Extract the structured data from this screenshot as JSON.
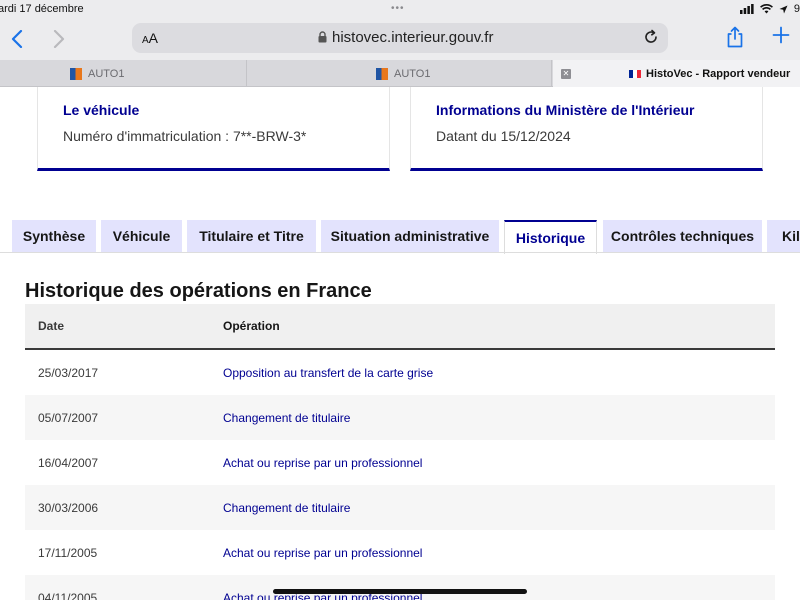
{
  "status": {
    "time": "ardi 17 décembre",
    "dots": "•••",
    "battery": "9"
  },
  "browser": {
    "aa_small": "A",
    "aa_large": "A",
    "url": "histovec.interieur.gouv.fr"
  },
  "tabs": [
    {
      "label": "AUTO1"
    },
    {
      "label": "AUTO1"
    },
    {
      "label": "HistoVec - Rapport vendeur"
    }
  ],
  "cards": {
    "vehicle": {
      "title": "Le véhicule",
      "text": "Numéro d'immatriculation : 7**-BRW-3*"
    },
    "ministry": {
      "title": "Informations du Ministère de l'Intérieur",
      "text": "Datant du 15/12/2024"
    }
  },
  "section_tabs": [
    {
      "label": "Synthèse"
    },
    {
      "label": "Véhicule"
    },
    {
      "label": "Titulaire et Titre"
    },
    {
      "label": "Situation administrative"
    },
    {
      "label": "Historique"
    },
    {
      "label": "Contrôles techniques"
    },
    {
      "label": "Kilo"
    }
  ],
  "history": {
    "title": "Historique des opérations en France",
    "headers": {
      "date": "Date",
      "operation": "Opération"
    },
    "rows": [
      {
        "date": "25/03/2017",
        "operation": "Opposition au transfert de la carte grise"
      },
      {
        "date": "05/07/2007",
        "operation": "Changement de titulaire"
      },
      {
        "date": "16/04/2007",
        "operation": "Achat ou reprise par un professionnel"
      },
      {
        "date": "30/03/2006",
        "operation": "Changement de titulaire"
      },
      {
        "date": "17/11/2005",
        "operation": "Achat ou reprise par un professionnel"
      },
      {
        "date": "04/11/2005",
        "operation": "Achat ou reprise par un professionnel"
      }
    ]
  },
  "colors": {
    "accent": "#000091",
    "tab_inactive": "#e3e3fd"
  }
}
